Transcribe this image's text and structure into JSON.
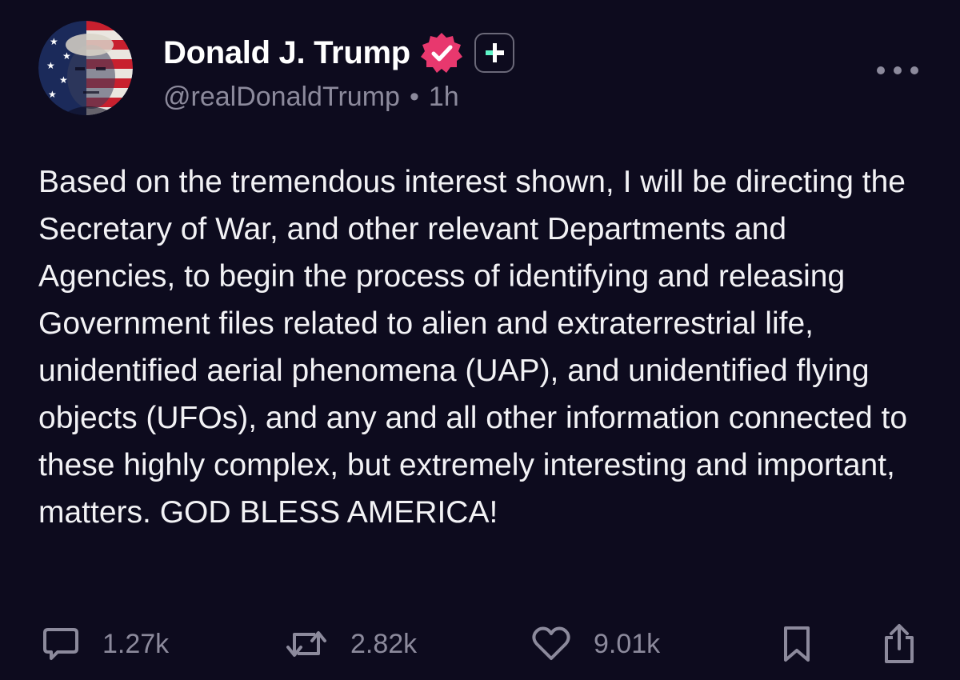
{
  "author": {
    "display_name": "Donald J. Trump",
    "handle": "@realDonaldTrump",
    "separator": "•",
    "time_ago": "1h",
    "verified_color": "#e8386e",
    "plus_color": "#5ff5c8"
  },
  "post": {
    "text": "Based on the tremendous interest shown, I will be directing the Secretary of War, and other relevant Departments and Agencies, to begin the process of identifying and releasing Government files related to alien and extraterrestrial life, unidentified aerial phenomena (UAP), and unidentified flying objects (UFOs), and any and all other information connected to these highly complex, but extremely interesting and important, matters. GOD BLESS AMERICA!"
  },
  "actions": {
    "replies": "1.27k",
    "reposts": "2.82k",
    "likes": "9.01k",
    "icons": [
      "comment-icon",
      "repost-icon",
      "heart-icon",
      "bookmark-icon",
      "share-icon",
      "more-icon"
    ]
  },
  "theme": {
    "background": "#0d0b1e",
    "muted_text": "#8c8a9c"
  }
}
